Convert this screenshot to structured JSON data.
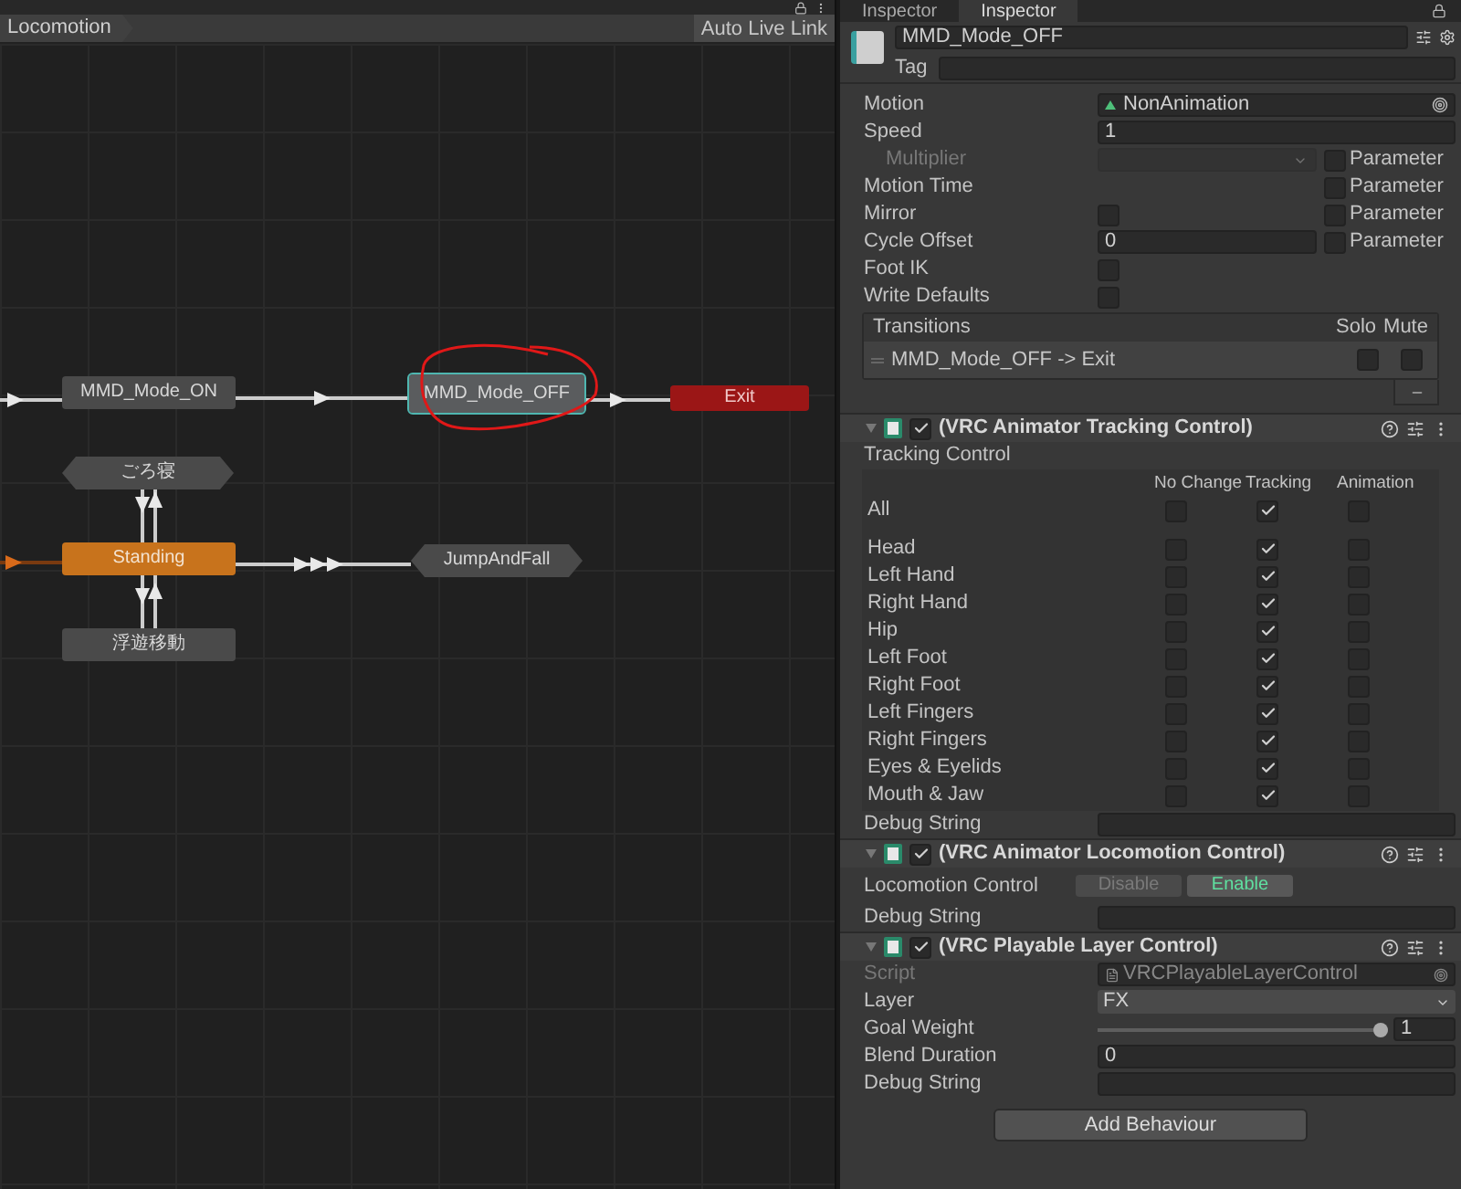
{
  "graph": {
    "breadcrumb": "Locomotion",
    "auto_live_link": "Auto Live Link",
    "nodes": [
      {
        "label": "MMD_Mode_ON",
        "kind": "state",
        "selected": false
      },
      {
        "label": "MMD_Mode_OFF",
        "kind": "state",
        "selected": true
      },
      {
        "label": "Exit",
        "kind": "exit",
        "selected": false
      },
      {
        "label": "ごろ寝",
        "kind": "machine",
        "selected": false
      },
      {
        "label": "Standing",
        "kind": "default",
        "selected": false
      },
      {
        "label": "JumpAndFall",
        "kind": "machine",
        "selected": false
      },
      {
        "label": "浮遊移動",
        "kind": "state",
        "selected": false
      }
    ]
  },
  "inspector": {
    "tabs": [
      {
        "label": "Inspector",
        "selected": false
      },
      {
        "label": "Inspector",
        "selected": true
      }
    ],
    "name": "MMD_Mode_OFF",
    "tag_label": "Tag",
    "properties": [
      {
        "label": "Motion",
        "kind": "object",
        "value": "NonAnimation"
      },
      {
        "label": "Speed",
        "kind": "text",
        "value": "1"
      },
      {
        "label": "Multiplier",
        "kind": "dropdown",
        "disabled": true,
        "parameter": {
          "label": "Parameter",
          "checked": false
        }
      },
      {
        "label": "Motion Time",
        "kind": "none",
        "parameter": {
          "label": "Parameter",
          "checked": false
        }
      },
      {
        "label": "Mirror",
        "kind": "checkbox",
        "checked": false,
        "parameter": {
          "label": "Parameter",
          "checked": false
        }
      },
      {
        "label": "Cycle Offset",
        "kind": "text",
        "value": "0",
        "parameter": {
          "label": "Parameter",
          "checked": false
        }
      },
      {
        "label": "Foot IK",
        "kind": "checkbox",
        "checked": false
      },
      {
        "label": "Write Defaults",
        "kind": "checkbox",
        "checked": false
      }
    ],
    "transitions": {
      "title": "Transitions",
      "solo": "Solo",
      "mute": "Mute",
      "items": [
        {
          "label": "MMD_Mode_OFF -> Exit",
          "solo": false,
          "mute": false
        }
      ]
    },
    "tracking": {
      "title": "(VRC Animator Tracking Control)",
      "enabled": true,
      "section_label": "Tracking Control",
      "columns": [
        "No Change",
        "Tracking",
        "Animation"
      ],
      "rows": [
        {
          "label": "All",
          "checks": [
            false,
            true,
            false
          ]
        },
        {
          "label": "Head",
          "checks": [
            false,
            true,
            false
          ]
        },
        {
          "label": "Left Hand",
          "checks": [
            false,
            true,
            false
          ]
        },
        {
          "label": "Right Hand",
          "checks": [
            false,
            true,
            false
          ]
        },
        {
          "label": "Hip",
          "checks": [
            false,
            true,
            false
          ]
        },
        {
          "label": "Left Foot",
          "checks": [
            false,
            true,
            false
          ]
        },
        {
          "label": "Right Foot",
          "checks": [
            false,
            true,
            false
          ]
        },
        {
          "label": "Left Fingers",
          "checks": [
            false,
            true,
            false
          ]
        },
        {
          "label": "Right Fingers",
          "checks": [
            false,
            true,
            false
          ]
        },
        {
          "label": "Eyes & Eyelids",
          "checks": [
            false,
            true,
            false
          ]
        },
        {
          "label": "Mouth & Jaw",
          "checks": [
            false,
            true,
            false
          ]
        }
      ],
      "debug_label": "Debug String"
    },
    "locomotion": {
      "title": "(VRC Animator Locomotion Control)",
      "enabled": true,
      "label": "Locomotion Control",
      "buttons": [
        {
          "label": "Disable",
          "selected": false
        },
        {
          "label": "Enable",
          "selected": true
        }
      ],
      "debug_label": "Debug String"
    },
    "playable": {
      "title": "(VRC Playable Layer Control)",
      "enabled": true,
      "script_label": "Script",
      "script_value": "VRCPlayableLayerControl",
      "layer_label": "Layer",
      "layer_value": "FX",
      "weight": {
        "label": "Goal Weight",
        "level": 1,
        "value": "1"
      },
      "blend_label": "Blend Duration",
      "blend_value": "0",
      "debug_label": "Debug String"
    },
    "add_behaviour": "Add Behaviour"
  }
}
